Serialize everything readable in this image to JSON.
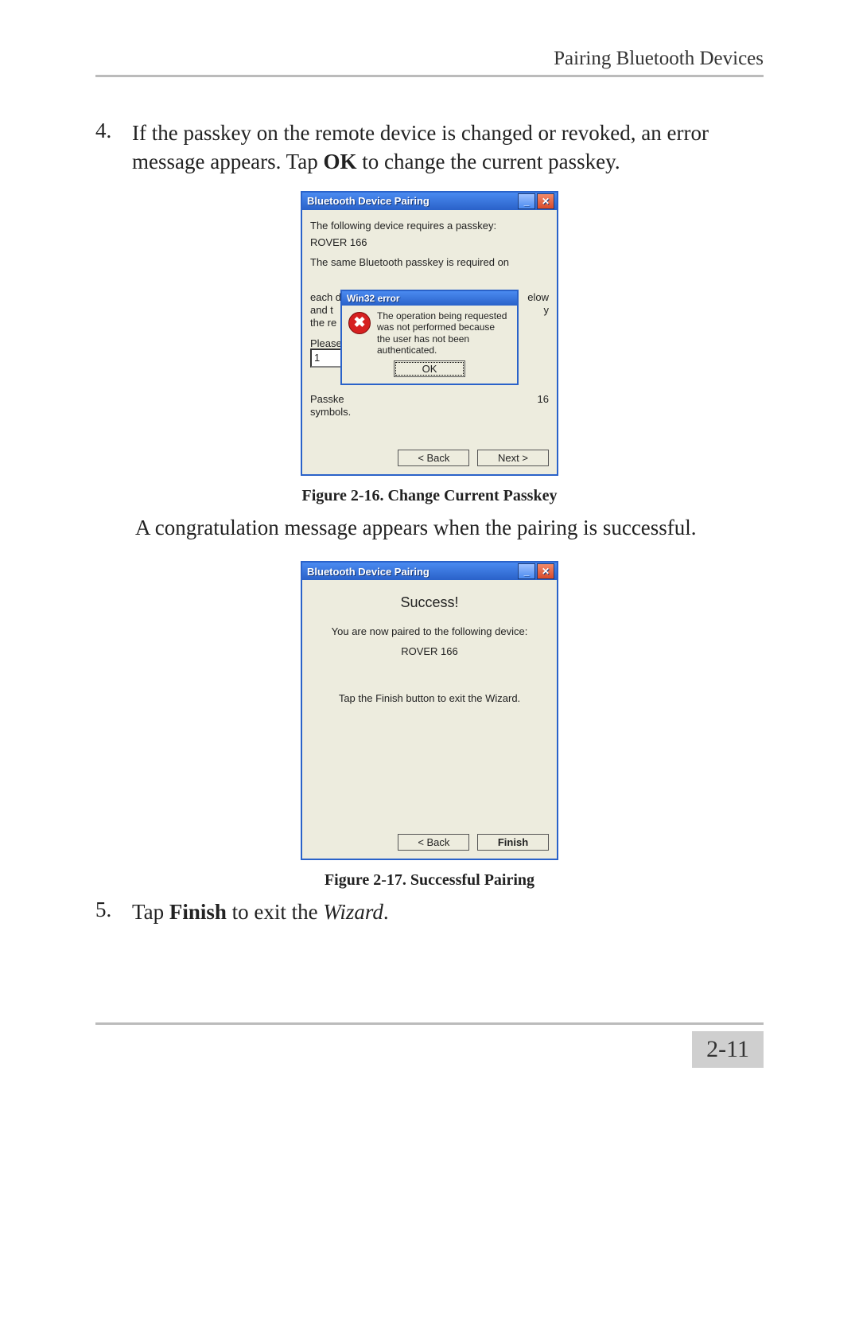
{
  "header": {
    "section": "Pairing Bluetooth Devices"
  },
  "step4": {
    "num": "4.",
    "text_before_bold": "If the passkey on the remote device is changed or revoked, an error message appears. Tap ",
    "bold": "OK",
    "text_after_bold": " to change the current passkey."
  },
  "win1": {
    "title": "Bluetooth Device Pairing",
    "line_requires": "The following device requires a passkey:",
    "device": "ROVER 166",
    "line_same_top": "The same Bluetooth passkey is required on",
    "frag_eachd": "each d",
    "frag_elow": "elow",
    "frag_andt": "and t",
    "frag_y": "y",
    "frag_there": "the re",
    "frag_please": "Please",
    "input_val": "1",
    "frag_passke": "Passke",
    "frag_16": "16",
    "frag_symbols": "symbols.",
    "back": "<  Back",
    "next": "Next  >"
  },
  "err": {
    "title": "Win32 error",
    "msg": "The operation being requested was not performed because the user has not been authenticated.",
    "ok": "OK"
  },
  "fig1_caption": "Figure 2-16. Change Current Passkey",
  "after_fig1": "A congratulation message appears when the pairing is successful.",
  "win2": {
    "title": "Bluetooth Device Pairing",
    "success": "Success!",
    "paired_line": "You are now paired to the following device:",
    "device": "ROVER 166",
    "exit_line": "Tap the Finish button to exit the Wizard.",
    "back": "<  Back",
    "finish": "Finish"
  },
  "fig2_caption": "Figure 2-17. Successful Pairing",
  "step5": {
    "num": "5.",
    "text_before_bold": "Tap ",
    "bold": "Finish",
    "text_mid": " to exit the ",
    "italic": "Wizard",
    "text_after": "."
  },
  "page_number": "2-11"
}
